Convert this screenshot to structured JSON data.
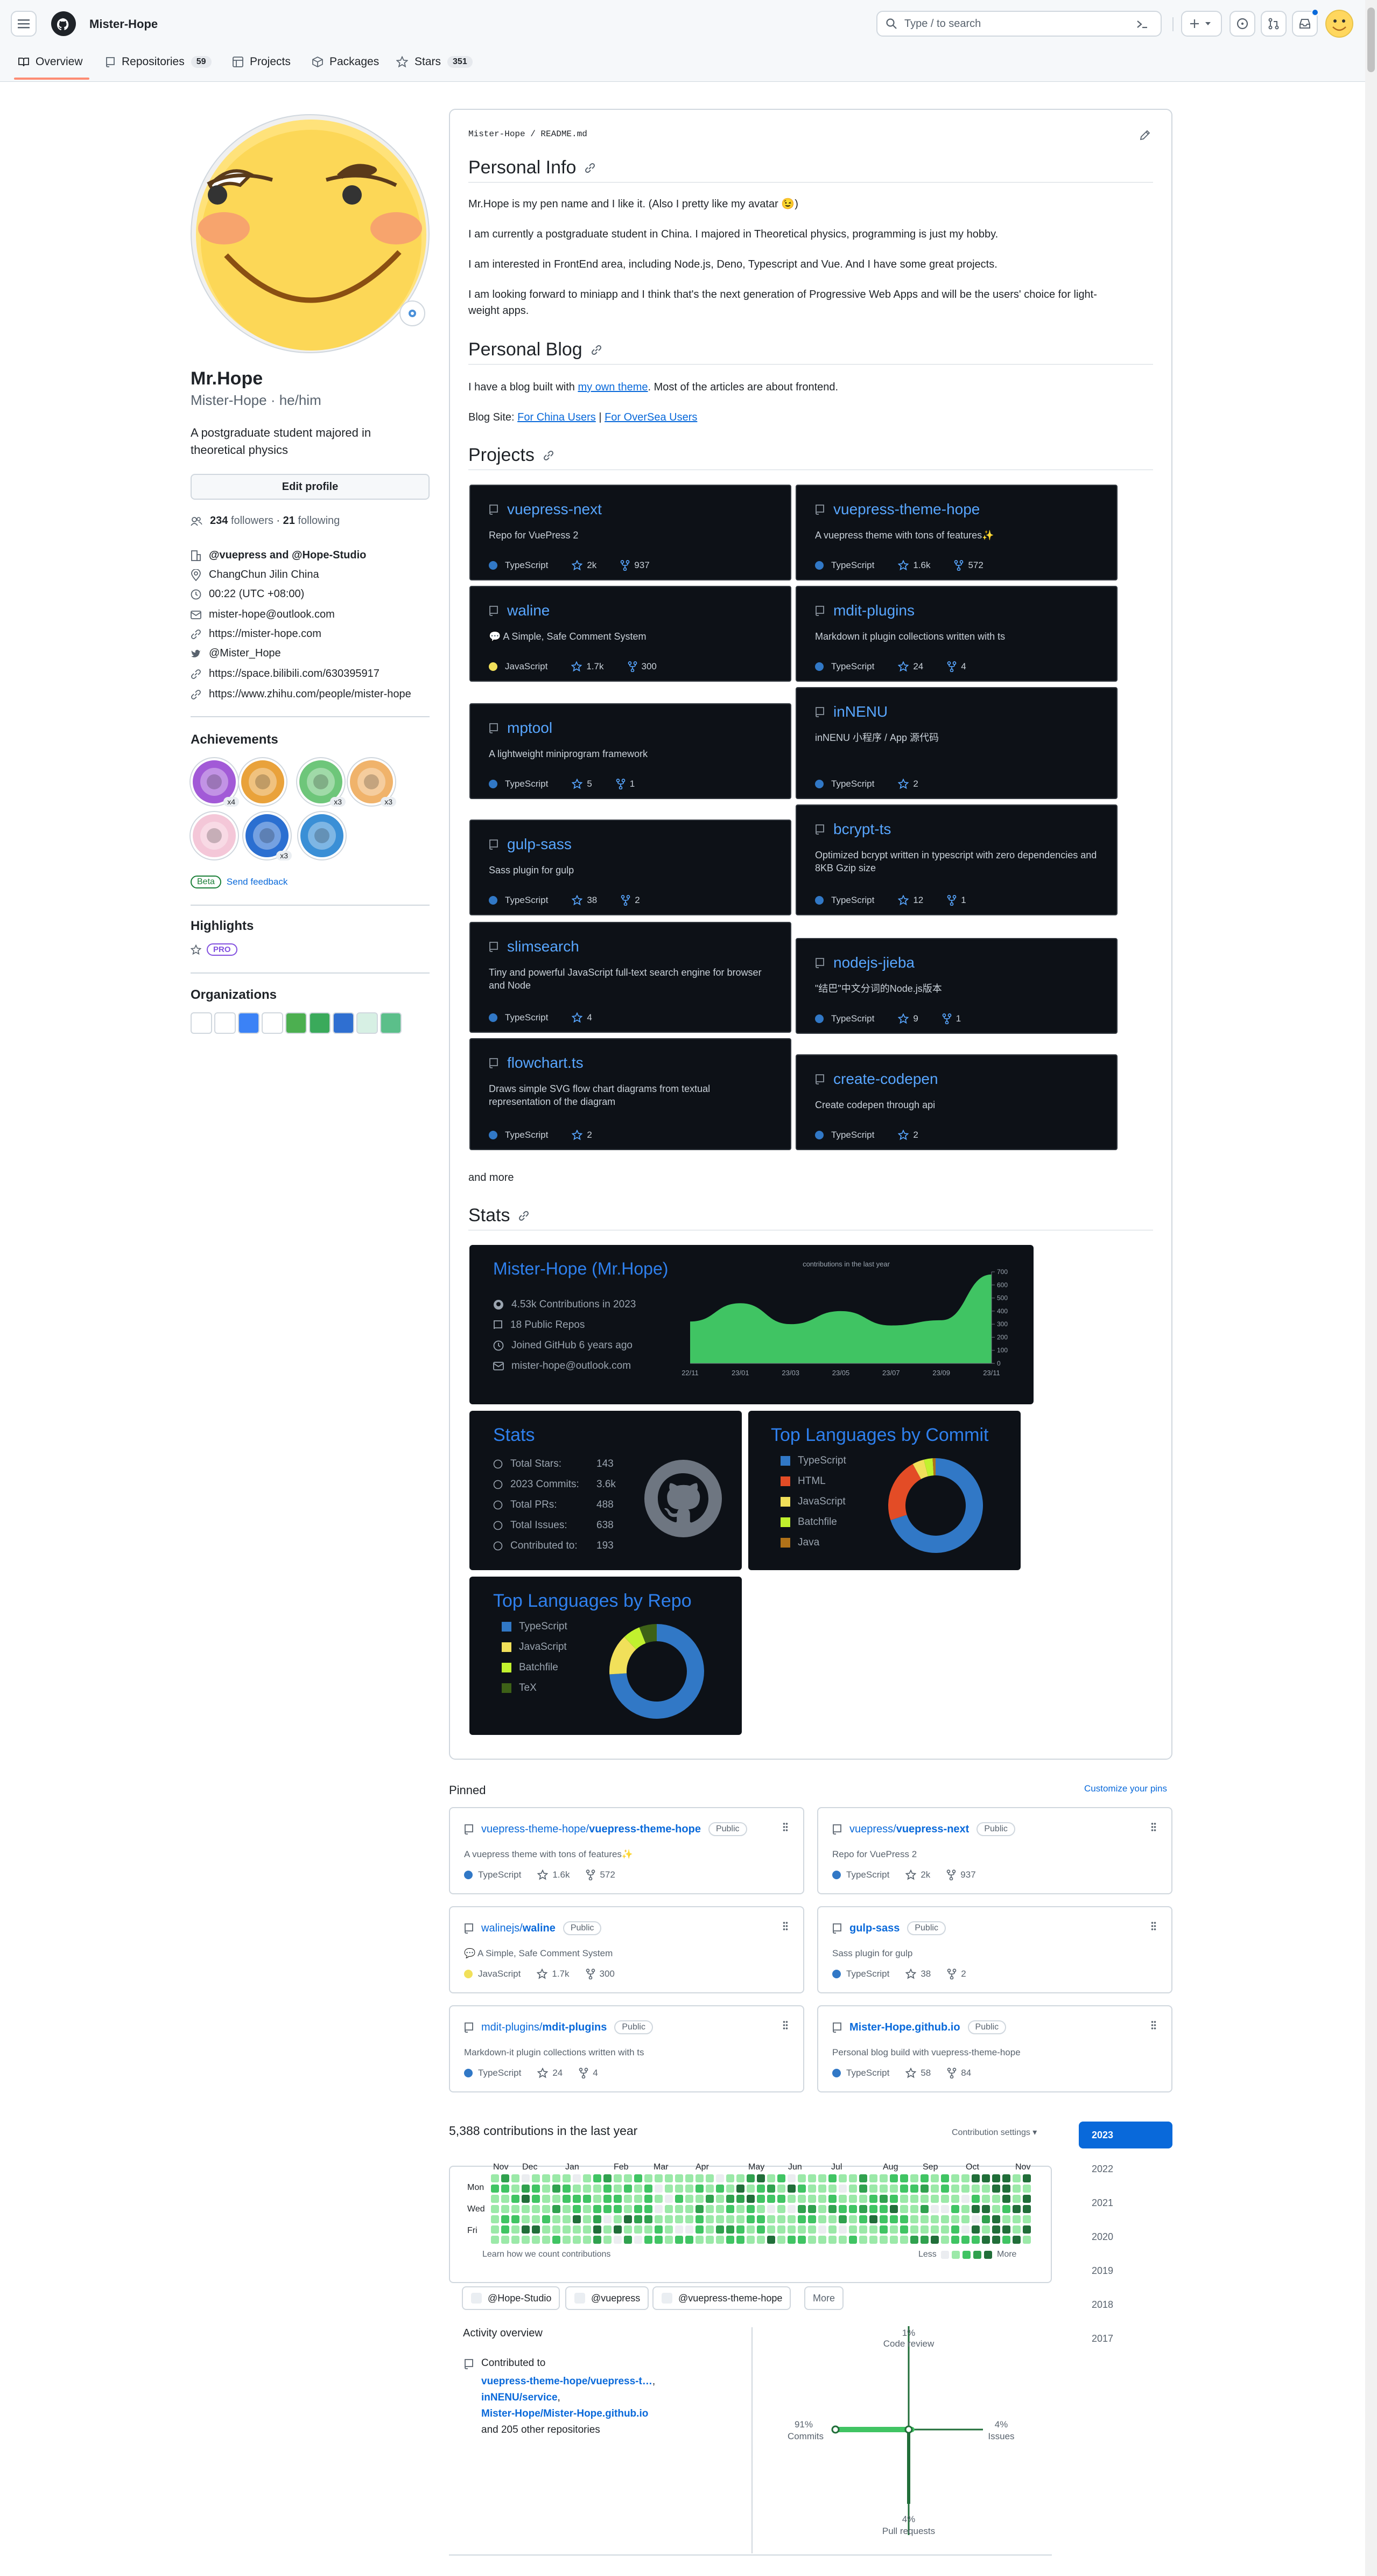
{
  "header": {
    "username": "Mister-Hope",
    "search_placeholder": "Type / to search",
    "tabs": [
      {
        "label": "Overview",
        "count": ""
      },
      {
        "label": "Repositories",
        "count": "59"
      },
      {
        "label": "Projects",
        "count": ""
      },
      {
        "label": "Packages",
        "count": ""
      },
      {
        "label": "Stars",
        "count": "351"
      }
    ]
  },
  "profile": {
    "name": "Mr.Hope",
    "login_pronouns": "Mister-Hope · he/him",
    "bio": "A postgraduate student majored in theoretical physics",
    "edit_label": "Edit profile",
    "followers_count": "234",
    "followers_label": "followers",
    "following_count": "21",
    "following_label": "following",
    "orgs_line": "@vuepress and @Hope-Studio",
    "location": "ChangChun Jilin China",
    "time": "00:22 (UTC +08:00)",
    "email": "mister-hope@outlook.com",
    "website": "https://mister-hope.com",
    "twitter": "@Mister_Hope",
    "bilibili": "https://space.bilibili.com/630395917",
    "zhihu": "https://www.zhihu.com/people/mister-hope",
    "achievements_title": "Achievements",
    "achievement_badges": [
      "x4",
      "",
      "x3",
      "x3",
      "",
      "x3",
      ""
    ],
    "beta": "Beta",
    "feedback": "Send feedback",
    "highlights_title": "Highlights",
    "pro": "PRO",
    "organizations_title": "Organizations"
  },
  "readme": {
    "path": "Mister-Hope / README.md",
    "personal_info": "Personal Info",
    "p1": "Mr.Hope is my pen name and I like it. (Also I pretty like my avatar 😉)",
    "p2": "I am currently a postgraduate student in China. I majored in Theoretical physics, programming is just my hobby.",
    "p3": "I am interested in FrontEnd area, including Node.js, Deno, Typescript and Vue. And I have some great projects.",
    "p4a": "I am looking forward to miniapp and I think that's the next generation of Progressive Web Apps and will be the users' choice for light-",
    "p4b": "weight apps.",
    "personal_blog": "Personal Blog",
    "blog_pre": "I have a blog built with ",
    "blog_link": "my own theme",
    "blog_post": ". Most of the articles are about frontend.",
    "blog_site": "Blog Site: ",
    "china": "For China Users",
    "sep": " | ",
    "oversea": "For OverSea Users",
    "projects": "Projects",
    "and_more": "and more",
    "stats": "Stats"
  },
  "projects": [
    {
      "name": "vuepress-next",
      "desc": "Repo for VuePress 2",
      "lang": "TypeScript",
      "color": "#3178c6",
      "stars": "2k",
      "forks": "937"
    },
    {
      "name": "vuepress-theme-hope",
      "desc": "A vuepress theme with tons of features✨",
      "lang": "TypeScript",
      "color": "#3178c6",
      "stars": "1.6k",
      "forks": "572"
    },
    {
      "name": "waline",
      "desc": "💬 A Simple, Safe Comment System",
      "lang": "JavaScript",
      "color": "#f1e05a",
      "stars": "1.7k",
      "forks": "300"
    },
    {
      "name": "mdit-plugins",
      "desc": "Markdown it plugin collections written with ts",
      "lang": "TypeScript",
      "color": "#3178c6",
      "stars": "24",
      "forks": "4"
    },
    {
      "name": "mptool",
      "desc": "A lightweight miniprogram framework",
      "lang": "TypeScript",
      "color": "#3178c6",
      "stars": "5",
      "forks": "1"
    },
    {
      "name": "inNENU",
      "desc": "inNENU 小程序 / App 源代码",
      "lang": "TypeScript",
      "color": "#3178c6",
      "stars": "2",
      "forks": ""
    },
    {
      "name": "gulp-sass",
      "desc": "Sass plugin for gulp",
      "lang": "TypeScript",
      "color": "#3178c6",
      "stars": "38",
      "forks": "2"
    },
    {
      "name": "bcrypt-ts",
      "desc": "Optimized bcrypt written in typescript with zero dependencies and 8KB Gzip size",
      "lang": "TypeScript",
      "color": "#3178c6",
      "stars": "12",
      "forks": "1"
    },
    {
      "name": "slimsearch",
      "desc": "Tiny and powerful JavaScript full-text search engine for browser and Node",
      "lang": "TypeScript",
      "color": "#3178c6",
      "stars": "4",
      "forks": ""
    },
    {
      "name": "nodejs-jieba",
      "desc": "\"结巴\"中文分词的Node.js版本",
      "lang": "TypeScript",
      "color": "#3178c6",
      "stars": "9",
      "forks": "1"
    },
    {
      "name": "flowchart.ts",
      "desc": "Draws simple SVG flow chart diagrams from textual representation of the diagram",
      "lang": "TypeScript",
      "color": "#3178c6",
      "stars": "2",
      "forks": ""
    },
    {
      "name": "create-codepen",
      "desc": "Create codepen through api",
      "lang": "TypeScript",
      "color": "#3178c6",
      "stars": "2",
      "forks": ""
    }
  ],
  "stats_card": {
    "title": "Mister-Hope (Mr.Hope)",
    "contributions": "4.53k Contributions in 2023",
    "repos": "18 Public Repos",
    "joined": "Joined GitHub 6 years ago",
    "email": "mister-hope@outlook.com",
    "chart_title": "contributions in the last year",
    "x_ticks": [
      "22/11",
      "23/01",
      "23/03",
      "23/05",
      "23/07",
      "23/09",
      "23/11"
    ],
    "y_ticks": [
      "700",
      "600",
      "500",
      "400",
      "300",
      "200",
      "100",
      "0"
    ]
  },
  "chart_data": {
    "type": "area",
    "title": "contributions in the last year",
    "x": [
      "22/11",
      "23/01",
      "23/03",
      "23/05",
      "23/07",
      "23/09",
      "23/11"
    ],
    "values": [
      320,
      460,
      300,
      400,
      290,
      330,
      680
    ],
    "ylim": [
      0,
      700
    ]
  },
  "stats2": {
    "title": "Stats",
    "rows": [
      {
        "label": "Total Stars:",
        "value": "143"
      },
      {
        "label": "2023 Commits:",
        "value": "3.6k"
      },
      {
        "label": "Total PRs:",
        "value": "488"
      },
      {
        "label": "Total Issues:",
        "value": "638"
      },
      {
        "label": "Contributed to:",
        "value": "193"
      }
    ]
  },
  "lang_commit": {
    "title": "Top Languages by Commit",
    "items": [
      {
        "name": "TypeScript",
        "color": "#3178c6"
      },
      {
        "name": "HTML",
        "color": "#e34c26"
      },
      {
        "name": "JavaScript",
        "color": "#f1e05a"
      },
      {
        "name": "Batchfile",
        "color": "#c1f12e"
      },
      {
        "name": "Java",
        "color": "#b07219"
      }
    ]
  },
  "lang_repo": {
    "title": "Top Languages by Repo",
    "items": [
      {
        "name": "TypeScript",
        "color": "#3178c6"
      },
      {
        "name": "JavaScript",
        "color": "#f1e05a"
      },
      {
        "name": "Batchfile",
        "color": "#c1f12e"
      },
      {
        "name": "TeX",
        "color": "#3d6117"
      }
    ]
  },
  "pinned": {
    "title": "Pinned",
    "customize": "Customize your pins",
    "public": "Public",
    "items": [
      {
        "owner": "vuepress-theme-hope/",
        "repo": "vuepress-theme-hope",
        "desc": "A vuepress theme with tons of features✨",
        "lang": "TypeScript",
        "color": "#3178c6",
        "stars": "1.6k",
        "forks": "572"
      },
      {
        "owner": "vuepress/",
        "repo": "vuepress-next",
        "desc": "Repo for VuePress 2",
        "lang": "TypeScript",
        "color": "#3178c6",
        "stars": "2k",
        "forks": "937"
      },
      {
        "owner": "walinejs/",
        "repo": "waline",
        "desc": "💬 A Simple, Safe Comment System",
        "lang": "JavaScript",
        "color": "#f1e05a",
        "stars": "1.7k",
        "forks": "300"
      },
      {
        "owner": "",
        "repo": "gulp-sass",
        "desc": "Sass plugin for gulp",
        "lang": "TypeScript",
        "color": "#3178c6",
        "stars": "38",
        "forks": "2"
      },
      {
        "owner": "mdit-plugins/",
        "repo": "mdit-plugins",
        "desc": "Markdown-it plugin collections written with ts",
        "lang": "TypeScript",
        "color": "#3178c6",
        "stars": "24",
        "forks": "4"
      },
      {
        "owner": "",
        "repo": "Mister-Hope.github.io",
        "desc": "Personal blog build with vuepress-theme-hope",
        "lang": "TypeScript",
        "color": "#3178c6",
        "stars": "58",
        "forks": "84"
      }
    ]
  },
  "contrib": {
    "title": "5,388 contributions in the last year",
    "settings": "Contribution settings ▾",
    "months": [
      "Nov",
      "Dec",
      "Jan",
      "Feb",
      "Mar",
      "Apr",
      "May",
      "Jun",
      "Jul",
      "Aug",
      "Sep",
      "Oct",
      "Nov"
    ],
    "days": [
      "Mon",
      "Wed",
      "Fri"
    ],
    "learn": "Learn how we count contributions",
    "less": "Less",
    "more": "More",
    "years": [
      "2023",
      "2022",
      "2021",
      "2020",
      "2019",
      "2018",
      "2017"
    ]
  },
  "activity": {
    "orgs": [
      "@Hope-Studio",
      "@vuepress",
      "@vuepress-theme-hope"
    ],
    "more_btn": "More",
    "overview_title": "Activity overview",
    "contributed_to": "Contributed to",
    "repo1": "vuepress-theme-hope/vuepress-t…",
    "repo2": "inNENU/service",
    "repo3": "Mister-Hope/Mister-Hope.github.io",
    "other": "and 205 other repositories",
    "code_review_pct": "1%",
    "code_review": "Code review",
    "commits_pct": "91%",
    "commits": "Commits",
    "issues_pct": "4%",
    "issues": "Issues",
    "prs_pct": "4%",
    "prs": "Pull requests"
  }
}
